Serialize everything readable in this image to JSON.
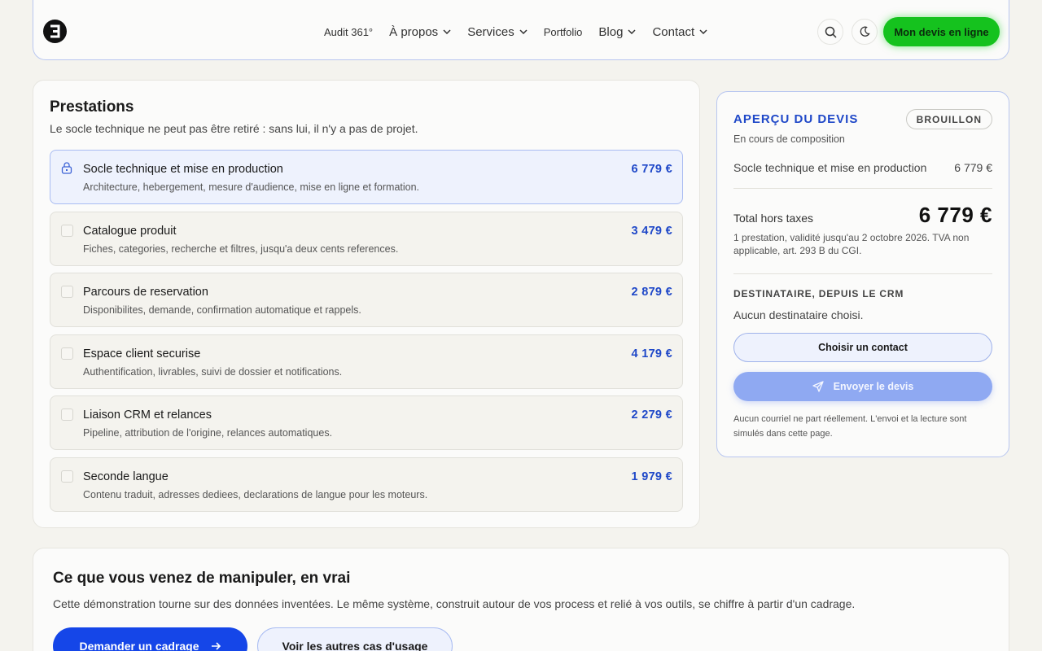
{
  "header": {
    "logo_icon": "logo-e-icon",
    "nav": [
      {
        "label": "Audit 361°",
        "dropdown": false
      },
      {
        "label": "À propos",
        "dropdown": true
      },
      {
        "label": "Services",
        "dropdown": true
      },
      {
        "label": "Portfolio",
        "dropdown": false
      },
      {
        "label": "Blog",
        "dropdown": true
      },
      {
        "label": "Contact",
        "dropdown": true
      }
    ],
    "search_icon": "search-icon",
    "theme_icon": "moon-icon",
    "cta_label": "Mon devis en ligne"
  },
  "prestations": {
    "title": "Prestations",
    "subtitle": "Le socle technique ne peut pas être retiré : sans lui, il n'y a pas de projet.",
    "items": [
      {
        "name": "Socle technique et mise en production",
        "desc": "Architecture, hebergement, mesure d'audience, mise en ligne et formation.",
        "price": "6 779 €",
        "locked": true,
        "checked": true
      },
      {
        "name": "Catalogue produit",
        "desc": "Fiches, categories, recherche et filtres, jusqu'a deux cents references.",
        "price": "3 479 €",
        "locked": false,
        "checked": false
      },
      {
        "name": "Parcours de reservation",
        "desc": "Disponibilites, demande, confirmation automatique et rappels.",
        "price": "2 879 €",
        "locked": false,
        "checked": false
      },
      {
        "name": "Espace client securise",
        "desc": "Authentification, livrables, suivi de dossier et notifications.",
        "price": "4 179 €",
        "locked": false,
        "checked": false
      },
      {
        "name": "Liaison CRM et relances",
        "desc": "Pipeline, attribution de l'origine, relances automatiques.",
        "price": "2 279 €",
        "locked": false,
        "checked": false
      },
      {
        "name": "Seconde langue",
        "desc": "Contenu traduit, adresses dediees, declarations de langue pour les moteurs.",
        "price": "1 979 €",
        "locked": false,
        "checked": false
      }
    ]
  },
  "devis": {
    "title": "APERÇU DU DEVIS",
    "badge": "BROUILLON",
    "status": "En cours de composition",
    "line_name": "Socle technique et mise en production",
    "line_price": "6 779 €",
    "total_label": "Total hors taxes",
    "total_value": "6 779 €",
    "total_note": "1 prestation, validité jusqu'au 2 octobre 2026. TVA non applicable, art. 293 B du CGI.",
    "dest_title": "DESTINATAIRE, DEPUIS LE CRM",
    "dest_none": "Aucun destinataire choisi.",
    "contact_button": "Choisir un contact",
    "send_button": "Envoyer le devis",
    "send_note": "Aucun courriel ne part réellement. L'envoi et la lecture sont simulés dans cette page."
  },
  "bottom": {
    "title": "Ce que vous venez de manipuler, en vrai",
    "subtitle": "Cette démonstration tourne sur des données inventées. Le même système, construit autour de vos process et relié à vos outils, se chiffre à partir d'un cadrage.",
    "primary_button": "Demander un cadrage",
    "secondary_button": "Voir les autres cas d'usage"
  },
  "colors": {
    "accent": "#1f48c8",
    "cta_green": "#15c21e",
    "primary_blue": "#1546e8"
  }
}
